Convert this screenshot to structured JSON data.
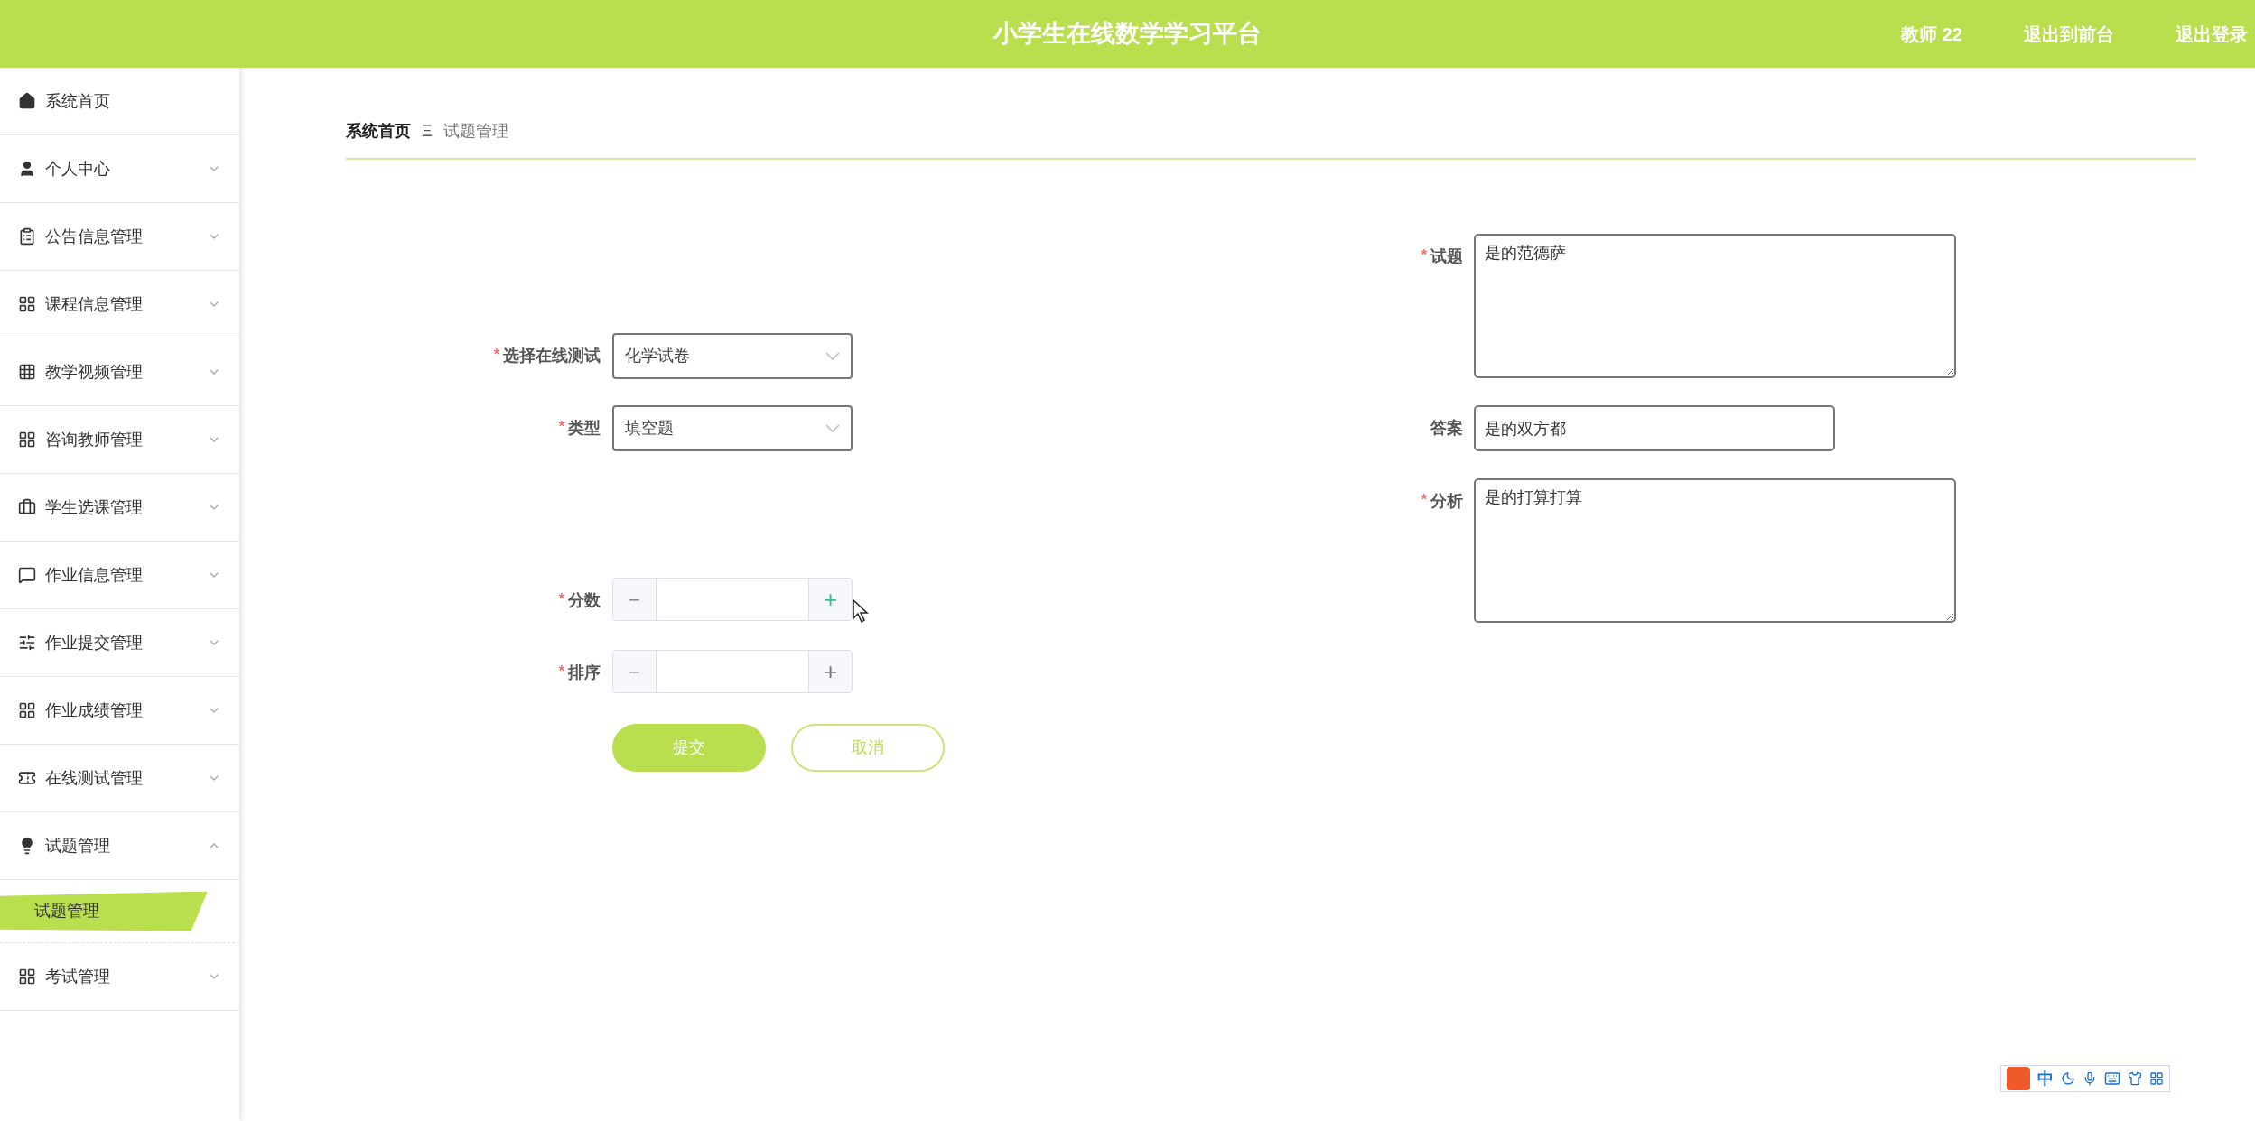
{
  "header": {
    "title": "小学生在线数学学习平台",
    "links": [
      "教师 22",
      "退出到前台",
      "退出登录"
    ]
  },
  "sidebar": {
    "items": [
      {
        "label": "系统首页",
        "kind": "link"
      },
      {
        "label": "个人中心",
        "kind": "submenu",
        "expanded": false
      },
      {
        "label": "公告信息管理",
        "kind": "submenu",
        "expanded": false
      },
      {
        "label": "课程信息管理",
        "kind": "submenu",
        "expanded": false
      },
      {
        "label": "教学视频管理",
        "kind": "submenu",
        "expanded": false
      },
      {
        "label": "咨询教师管理",
        "kind": "submenu",
        "expanded": false
      },
      {
        "label": "学生选课管理",
        "kind": "submenu",
        "expanded": false
      },
      {
        "label": "作业信息管理",
        "kind": "submenu",
        "expanded": false
      },
      {
        "label": "作业提交管理",
        "kind": "submenu",
        "expanded": false
      },
      {
        "label": "作业成绩管理",
        "kind": "submenu",
        "expanded": false
      },
      {
        "label": "在线测试管理",
        "kind": "submenu",
        "expanded": false
      },
      {
        "label": "试题管理",
        "kind": "submenu",
        "expanded": true,
        "children": [
          {
            "label": "试题管理",
            "selected": true
          }
        ]
      },
      {
        "label": "考试管理",
        "kind": "submenu",
        "expanded": false
      }
    ]
  },
  "breadcrumb": {
    "items": [
      "系统首页",
      "试题管理"
    ],
    "separator": "Ξ"
  },
  "form": {
    "left": [
      {
        "label": "选择在线测试",
        "marker": "*",
        "kind": "select",
        "value": "化学试卷"
      },
      {
        "label": "类型",
        "marker": "*",
        "kind": "select",
        "value": "填空题"
      },
      {
        "label": "分数",
        "marker": "*",
        "kind": "number",
        "minus": "−",
        "plus": "+"
      },
      {
        "label": "排序",
        "marker": "*",
        "kind": "number",
        "minus": "−",
        "plus": "+"
      }
    ],
    "right": [
      {
        "label": "试题",
        "marker": "*",
        "kind": "textarea",
        "value": "是的范德萨"
      },
      {
        "label": "答案",
        "kind": "input",
        "value": "是的双方都"
      },
      {
        "label": "分析",
        "marker": "*",
        "kind": "textarea",
        "value": "是的打算打算"
      }
    ],
    "buttons": [
      {
        "label": "提交",
        "kind": "primary"
      },
      {
        "label": "取消",
        "kind": "secondary"
      }
    ]
  },
  "ime_toolbar": {
    "mode": "中"
  }
}
